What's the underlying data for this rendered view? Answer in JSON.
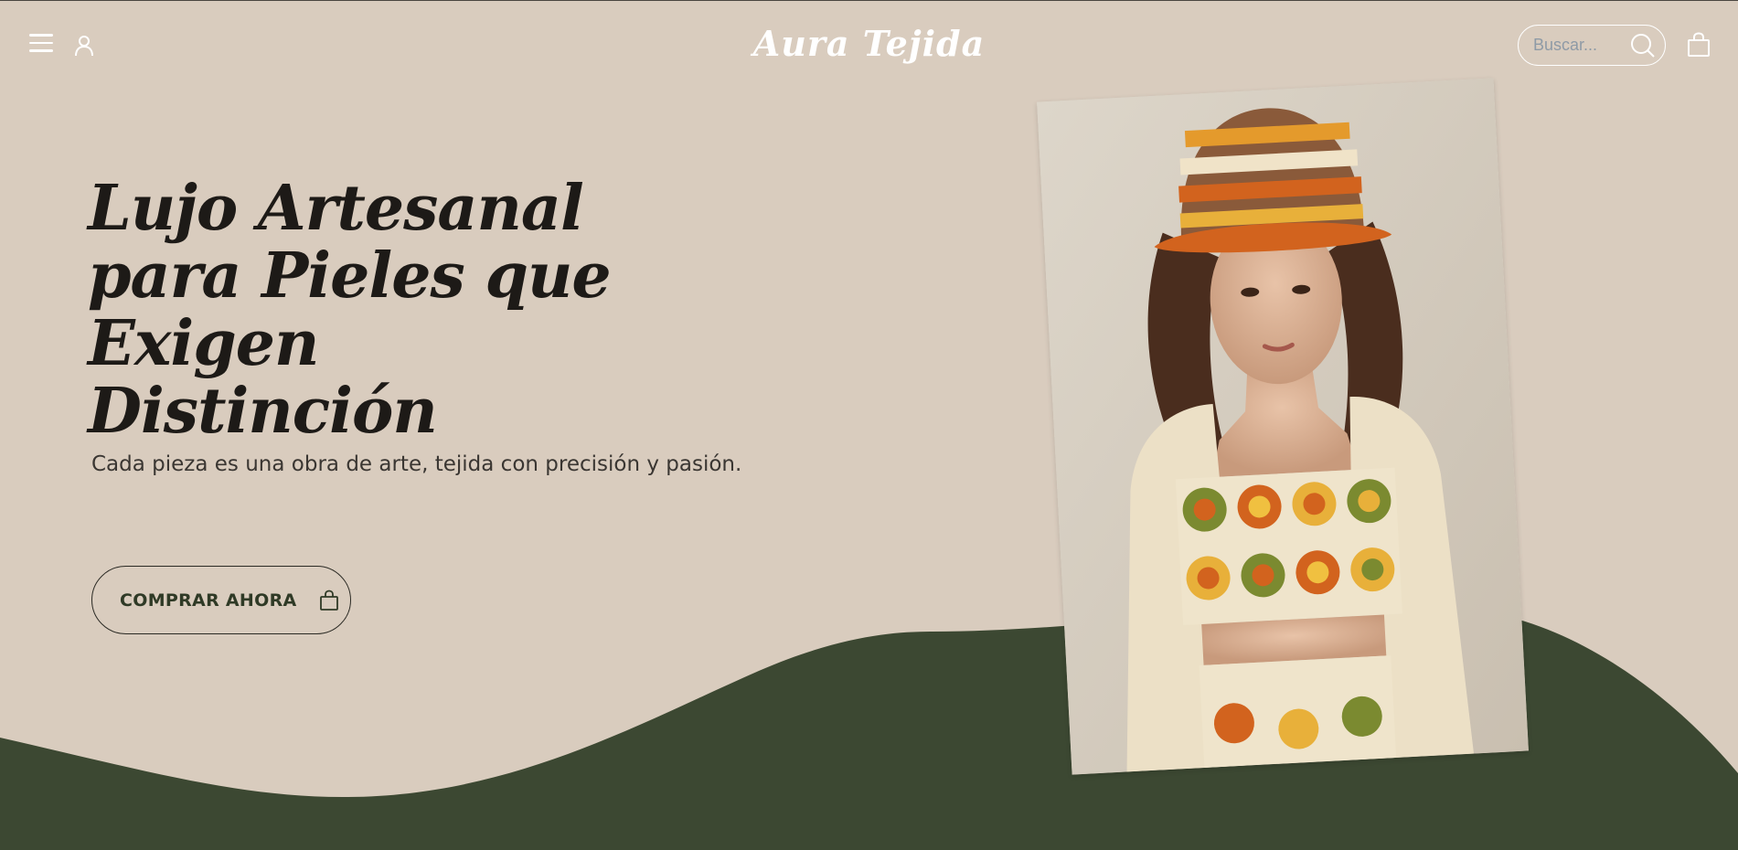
{
  "header": {
    "menu_icon": "hamburger-menu-icon",
    "account_icon": "user-icon",
    "logo": "Aura Tejida",
    "search": {
      "placeholder": "Buscar...",
      "value": ""
    },
    "search_icon": "search-icon",
    "cart_icon": "shopping-bag-icon"
  },
  "hero": {
    "title_lines": [
      "Lujo Artesanal",
      "para Pieles que",
      "Exigen Distinción"
    ],
    "subtitle": "Cada pieza es una obra de arte, tejida con precisión y pasión.",
    "cta_label": "COMPRAR AHORA",
    "cta_icon": "shopping-bag-icon",
    "image_subject": "model-wearing-crochet-hat-and-top"
  },
  "colors": {
    "background": "#d9ccbe",
    "wave": "#3c4832",
    "text_dark": "#1d1a17",
    "header_icons": "#ffffff"
  }
}
